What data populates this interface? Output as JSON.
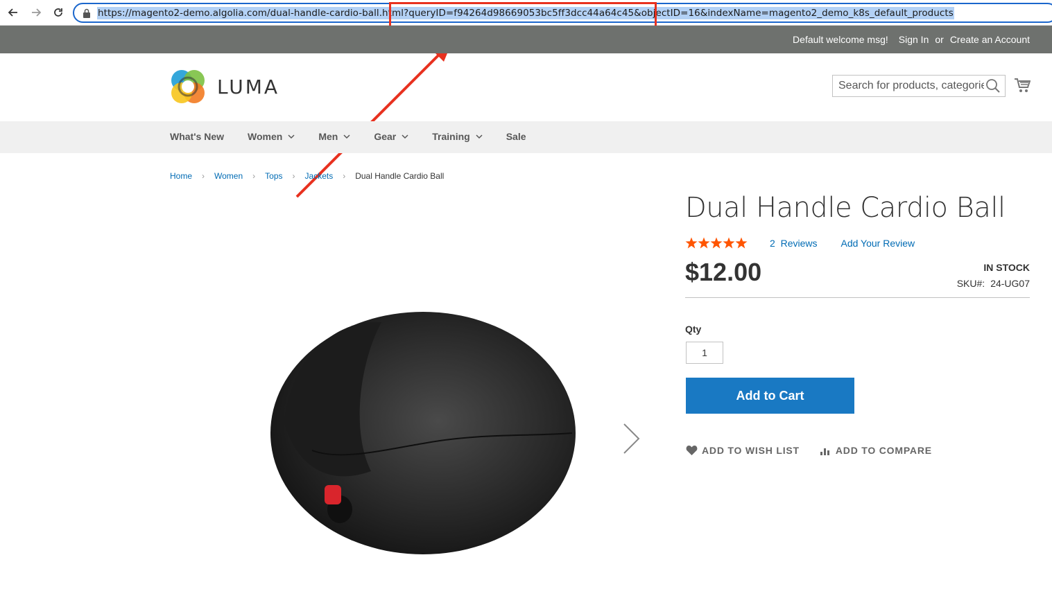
{
  "browser": {
    "url": "https://magento2-demo.algolia.com/dual-handle-cardio-ball.html?queryID=f94264d98669053bc5ff3dcc44a64c45&objectID=16&indexName=magento2_demo_k8s_default_products",
    "back_icon": "arrow-left-icon",
    "forward_icon": "arrow-right-icon",
    "reload_icon": "reload-icon"
  },
  "header_panel": {
    "welcome": "Default welcome msg!",
    "sign_in": "Sign In",
    "or": "or",
    "create_account": "Create an Account"
  },
  "logo": {
    "text": "LUMA"
  },
  "search": {
    "placeholder": "Search for products, categories, ..."
  },
  "nav": {
    "items": [
      {
        "label": "What's New",
        "has_dropdown": false
      },
      {
        "label": "Women",
        "has_dropdown": true
      },
      {
        "label": "Men",
        "has_dropdown": true
      },
      {
        "label": "Gear",
        "has_dropdown": true
      },
      {
        "label": "Training",
        "has_dropdown": true
      },
      {
        "label": "Sale",
        "has_dropdown": false
      }
    ]
  },
  "breadcrumbs": {
    "items": [
      "Home",
      "Women",
      "Tops",
      "Jackets"
    ],
    "current": "Dual Handle Cardio Ball"
  },
  "product": {
    "title": "Dual Handle Cardio Ball",
    "rating_stars": 5,
    "reviews_count": "2",
    "reviews_label": "Reviews",
    "add_review": "Add Your Review",
    "price": "$12.00",
    "stock": "IN STOCK",
    "sku_label": "SKU#:",
    "sku": "24-UG07",
    "qty_label": "Qty",
    "qty_value": "1",
    "add_to_cart": "Add to Cart",
    "add_to_wishlist": "ADD TO WISH LIST",
    "add_to_compare": "ADD TO COMPARE"
  },
  "colors": {
    "accent": "#1979c3",
    "link": "#006bb4",
    "star": "#ff5501",
    "annotation": "#e8311f",
    "panel_header": "#6e716e"
  }
}
